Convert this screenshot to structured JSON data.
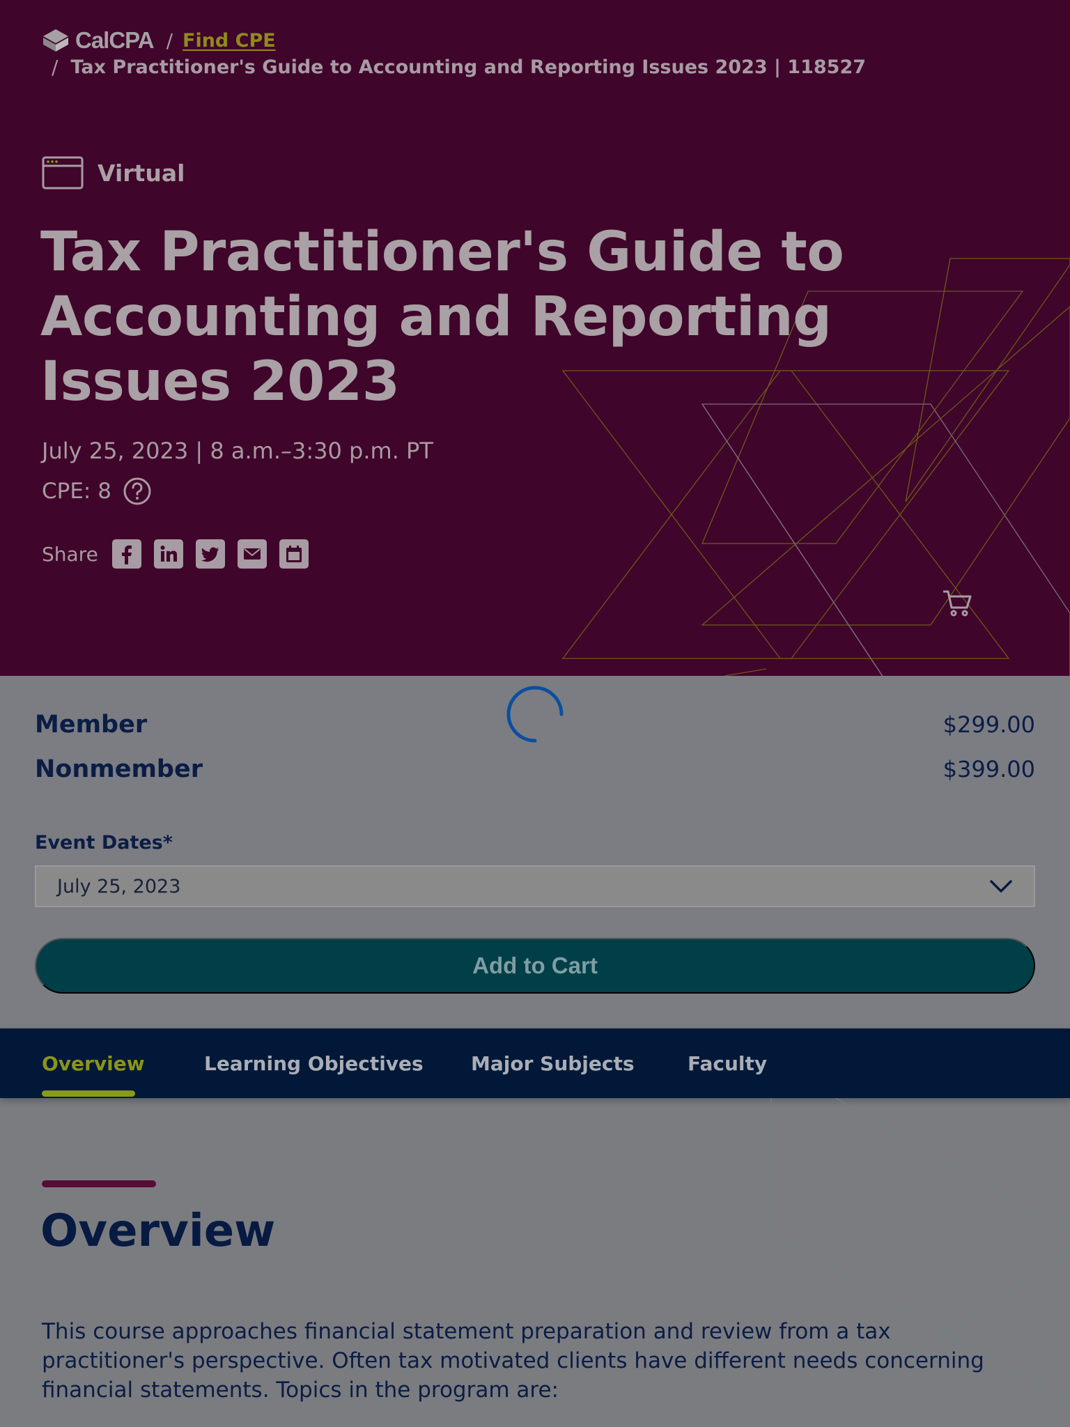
{
  "breadcrumb": {
    "brand": "CalCPA",
    "separator": "/",
    "find_cpe": "Find CPE",
    "current": "Tax Practitioner's Guide to Accounting and Reporting Issues 2023 | 118527"
  },
  "hero": {
    "format_icon": "browser-window-icon",
    "format_label": "Virtual",
    "title": "Tax Practitioner's Guide to Accounting and Reporting Issues 2023",
    "datetime": "July 25, 2023 | 8 a.m.–3:30 p.m. PT",
    "cpe": "CPE: 8",
    "share_label": "Share",
    "share_icons": [
      "facebook-icon",
      "linkedin-icon",
      "twitter-icon",
      "email-icon",
      "calendar-icon"
    ]
  },
  "pricing": {
    "member_label": "Member",
    "member_price": "$299.00",
    "nonmember_label": "Nonmember",
    "nonmember_price": "$399.00"
  },
  "event_dates": {
    "label": "Event Dates*",
    "selected": "July 25, 2023"
  },
  "add_to_cart": "Add to Cart",
  "tabs": [
    {
      "label": "Overview",
      "active": true
    },
    {
      "label": "Learning Objectives",
      "active": false
    },
    {
      "label": "Major Subjects",
      "active": false
    },
    {
      "label": "Faculty",
      "active": false
    }
  ],
  "overview": {
    "heading": "Overview",
    "body": "This course approaches financial statement preparation and review from a tax practitioner's perspective. Often tax motivated clients have different needs concerning financial statements. Topics in the program are:"
  },
  "colors": {
    "hero_bg": "#40052a",
    "overlay_bg": "#7b7d83",
    "tabs_bg": "#011839",
    "accent_olive": "#8a9a1a",
    "button_teal": "#003f48"
  }
}
